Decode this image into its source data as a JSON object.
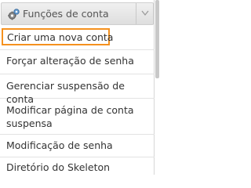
{
  "header": {
    "title": "Funções de conta",
    "icon": "gears-icon",
    "toggle_icon": "chevron-down-icon"
  },
  "menu": {
    "items": [
      {
        "label": "Criar uma nova conta",
        "selected": true
      },
      {
        "label": "Forçar alteração de senha",
        "selected": false
      },
      {
        "label": "Gerenciar suspensão de conta",
        "selected": false
      },
      {
        "label": "Modificar página de conta suspensa",
        "selected": false
      },
      {
        "label": "Modificação de senha",
        "selected": false
      },
      {
        "label": "Diretório do Skeleton",
        "selected": false
      }
    ]
  },
  "colors": {
    "highlight_border": "#f5911e",
    "header_bg": "#e6e6e6",
    "text": "#333333"
  }
}
